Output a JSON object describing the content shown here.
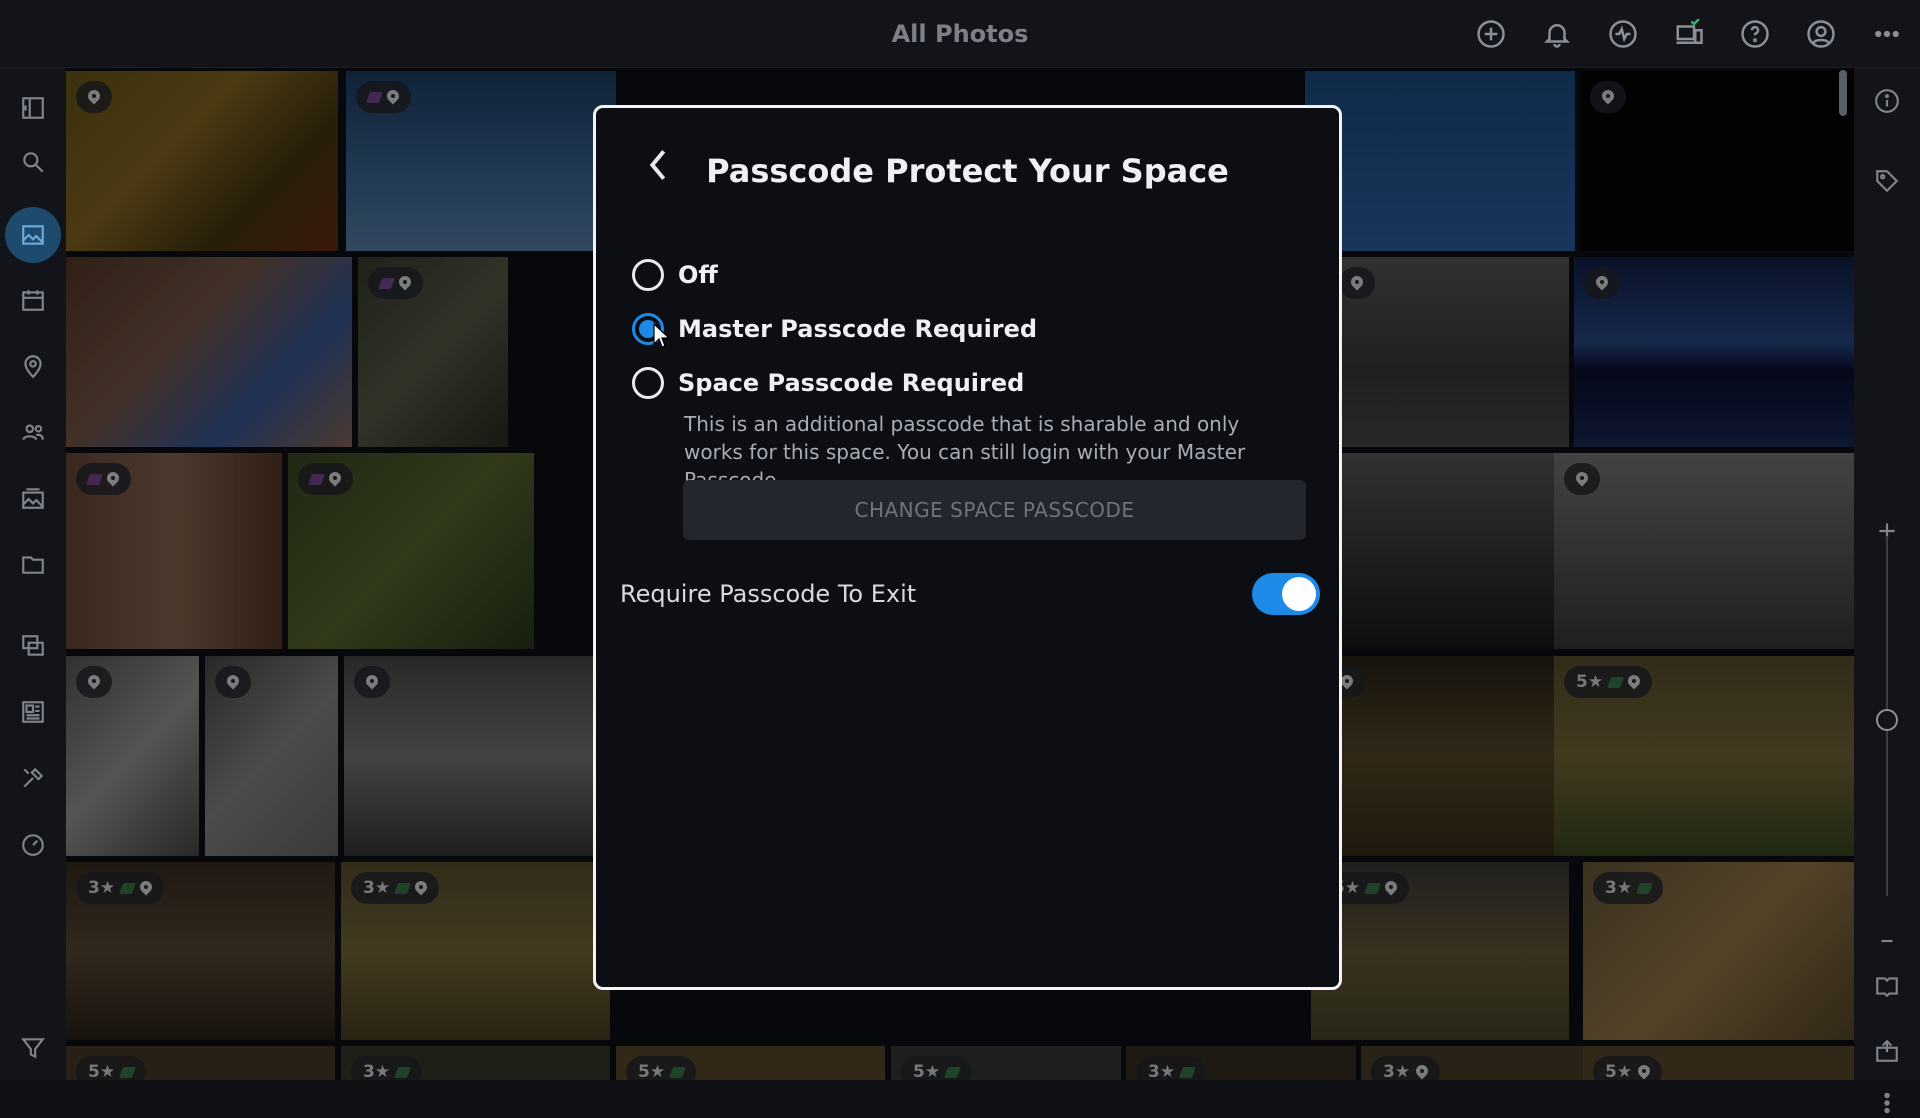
{
  "topbar": {
    "title": "All Photos",
    "icons": [
      "add-icon",
      "bell-icon",
      "activity-icon",
      "devices-icon",
      "help-icon",
      "account-icon",
      "more-icon"
    ]
  },
  "sidebar_left": {
    "items": [
      "sidebar-toggle-icon",
      "search-icon",
      "photos-icon",
      "calendar-icon",
      "map-pin-icon",
      "people-icon",
      "albums-icon",
      "folder-icon",
      "stacks-icon",
      "layout-icon",
      "tools-icon",
      "dashboard-icon",
      "filter-icon"
    ],
    "active": "photos-icon"
  },
  "sidebar_right": {
    "items": [
      "info-icon",
      "tag-icon",
      "zoom-in-icon",
      "zoom-out-icon",
      "book-icon",
      "export-icon",
      "more-vertical-icon"
    ],
    "zoom_level": 0.5
  },
  "grid": {
    "badges": {
      "3star": "3★",
      "5star": "5★"
    }
  },
  "modal": {
    "title": "Passcode Protect Your Space",
    "options": [
      {
        "label": "Off",
        "checked": false
      },
      {
        "label": "Master Passcode Required",
        "checked": true
      },
      {
        "label": "Space Passcode Required",
        "checked": false
      }
    ],
    "description": "This is an additional passcode that is sharable and only works for this space. You can still login with your Master Passcode.",
    "change_button": "CHANGE SPACE PASSCODE",
    "exit_toggle": {
      "label": "Require Passcode To Exit",
      "on": true
    },
    "colors": {
      "accent": "#1e8ae8",
      "border": "#f2f3f5"
    }
  }
}
